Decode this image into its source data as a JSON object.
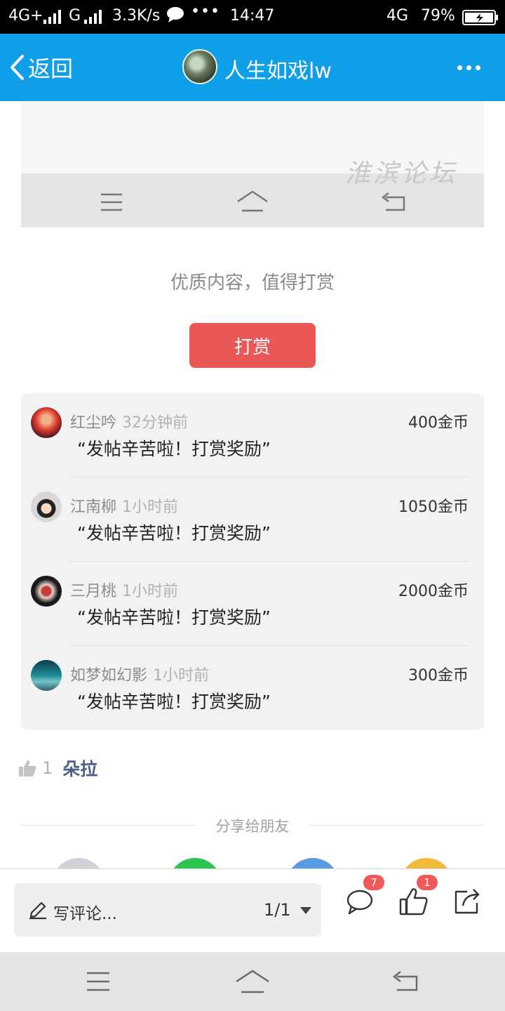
{
  "status_bar": {
    "network_left": "4G+",
    "network_mid": "G",
    "speed": "3.3K/s",
    "dots": "•••",
    "time": "14:47",
    "network_right": "4G",
    "battery_percent": "79%"
  },
  "header": {
    "back_label": "返回",
    "title": "人生如戏lw"
  },
  "watermark": "淮滨论坛",
  "reward": {
    "prompt": "优质内容，值得打赏",
    "button_label": "打赏"
  },
  "reward_list": [
    {
      "name": "红尘吟",
      "time": "32分钟前",
      "amount": "400金币",
      "message": "“发帖辛苦啦！打赏奖励”"
    },
    {
      "name": "江南柳",
      "time": "1小时前",
      "amount": "1050金币",
      "message": "“发帖辛苦啦！打赏奖励”"
    },
    {
      "name": "三月桃",
      "time": "1小时前",
      "amount": "2000金币",
      "message": "“发帖辛苦啦！打赏奖励”"
    },
    {
      "name": "如梦如幻影",
      "time": "1小时前",
      "amount": "300金币",
      "message": "“发帖辛苦啦！打赏奖励”"
    }
  ],
  "likes": {
    "count": "1",
    "user": "朵拉"
  },
  "share": {
    "title": "分享给朋友",
    "colors": [
      "#cfd3d8",
      "#2ec24f",
      "#5b9be0",
      "#f2bc3b"
    ]
  },
  "bottom_bar": {
    "comment_placeholder": "写评论...",
    "page": "1/1",
    "comment_badge": "7",
    "like_badge": "1"
  },
  "colors": {
    "header_bg": "#0f9ee8",
    "reward_button": "#e95757",
    "badge": "#f0595a",
    "like_user": "#4b5f86"
  }
}
